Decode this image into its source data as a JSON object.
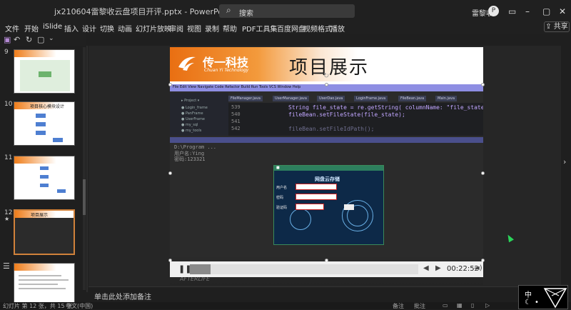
{
  "window": {
    "title": "jx210604雷黎收云盘项目开评.pptx - PowerPoint",
    "search_placeholder": "搜索",
    "user": "雷黎收",
    "avatar": "P"
  },
  "menu": [
    "文件",
    "开始",
    "iSlide",
    "插入",
    "设计",
    "切换",
    "动画",
    "幻灯片放映",
    "审阅",
    "视图",
    "录制",
    "帮助",
    "PDF工具集",
    "百度网盘",
    "视频格式",
    "播放"
  ],
  "share_label": "共享",
  "thumbnails": [
    {
      "num": "9",
      "label": ""
    },
    {
      "num": "10",
      "label": "项目核心模块设计"
    },
    {
      "num": "11",
      "label": ""
    },
    {
      "num": "12",
      "label": "项目展示"
    },
    {
      "num": "13",
      "label": ""
    }
  ],
  "slide": {
    "logo_cn": "传一科技",
    "logo_en": "Chuan Yi Technology",
    "title": "项目展示",
    "code_lines": [
      {
        "n": "539",
        "code": "String file_state = re.getString( columnName: \"file_state\");"
      },
      {
        "n": "540",
        "code": "fileBean.setFileState(file_state);"
      },
      {
        "n": "541",
        "code": ""
      },
      {
        "n": "542",
        "code": "fileBean.setFileIdPath();"
      }
    ],
    "console": [
      "D:\\Program ...",
      "用户名:Ying",
      "密码:123321"
    ],
    "login_title": "网盘云存储",
    "login_labels": [
      "用户名",
      "密码",
      "验证码"
    ],
    "watermark": "AFTERLIFE"
  },
  "player": {
    "time": "00:22:52",
    "progress": 0.09
  },
  "notes_placeholder": "单击此处添加备注",
  "status": {
    "slide_info": "幻灯片 第 12 张，共 15 张",
    "lang": "中文(中国)",
    "notes_btn": "备注",
    "comments_btn": "批注"
  },
  "ime": {
    "lang": "中"
  }
}
